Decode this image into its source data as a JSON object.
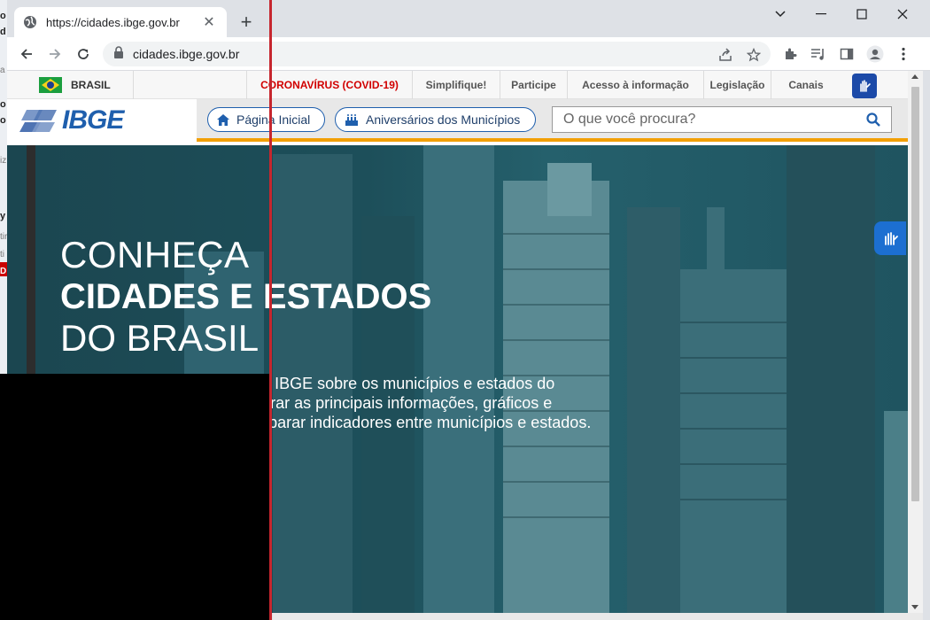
{
  "browser": {
    "tab": {
      "title": "https://cidades.ibge.gov.br"
    },
    "url": "cidades.ibge.gov.br"
  },
  "govbar": {
    "country": "BRASIL",
    "links": [
      {
        "label": "CORONAVÍRUS (COVID-19)"
      },
      {
        "label": "Simplifique!"
      },
      {
        "label": "Participe"
      },
      {
        "label": "Acesso à informação"
      },
      {
        "label": "Legislação"
      },
      {
        "label": "Canais"
      }
    ]
  },
  "header": {
    "logo": "IBGE",
    "home_label": "Página Inicial",
    "anniversary_label": "Aniversários dos Municípios",
    "search_placeholder": "O que você procura?"
  },
  "hero": {
    "line1": "CONHEÇA",
    "line2": "CIDADES E ESTADOS",
    "line3": "DO BRASIL",
    "description": "Agregador de informações do IBGE sobre os municípios e estados do Brasil. Aqui você pode encontrar as principais informações, gráficos e mapas. Além disso pode comparar indicadores entre municípios e estados."
  },
  "overlay": {
    "fragments": [
      "o",
      "d",
      "a",
      "iz",
      "ti",
      "o",
      "o",
      "y",
      "tir",
      "D"
    ]
  },
  "colors": {
    "accent": "#1f5fad",
    "stripe": "#f29f05",
    "covid": "#d10000",
    "split_line": "#c6262e"
  }
}
